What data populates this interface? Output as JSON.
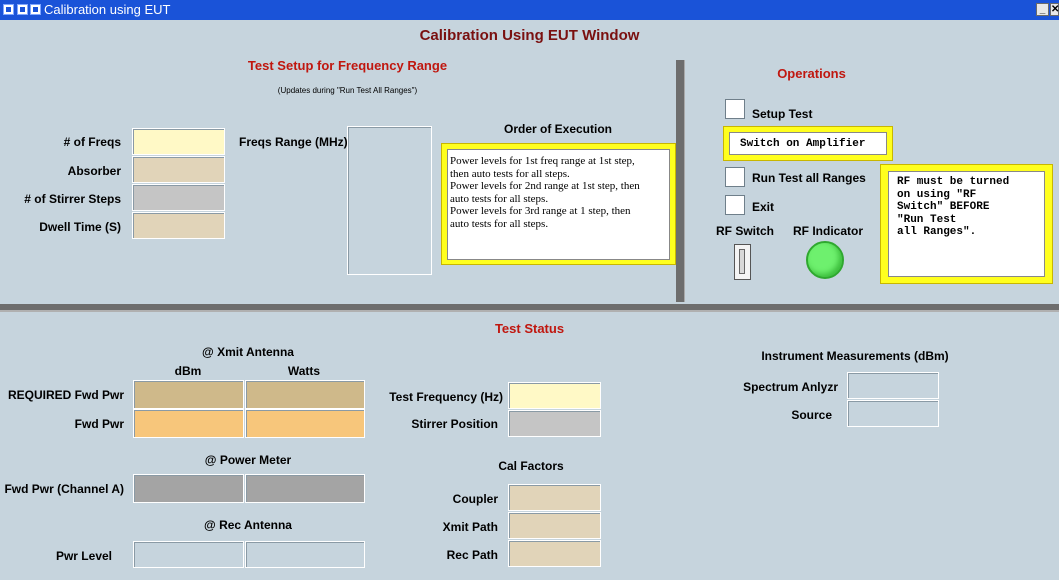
{
  "window": {
    "title": "Calibration using EUT"
  },
  "main_title": "Calibration Using EUT Window",
  "setup": {
    "title": "Test Setup for Frequency Range",
    "note": "(Updates during \"Run Test All Ranges\")",
    "num_freqs_label": "# of Freqs",
    "absorber_label": "Absorber",
    "stirrer_steps_label": "# of Stirrer Steps",
    "dwell_time_label": "Dwell Time (S)",
    "freqs_range_label": "Freqs Range (MHz)",
    "order_title": "Order of Execution",
    "order_lines": [
      "Power levels for 1st freq range at 1st step,",
      "then auto tests for all steps.",
      "Power levels for 2nd range at 1st step, then",
      "auto tests for all steps.",
      "Power levels for 3rd range at 1 step, then",
      "auto tests for all steps."
    ]
  },
  "operations": {
    "title": "Operations",
    "setup_test_label": "Setup Test",
    "switch_amp_text": "Switch on Amplifier",
    "run_all_label": "Run Test all Ranges",
    "exit_label": "Exit",
    "rf_switch_label": "RF Switch",
    "rf_indicator_label": "RF Indicator",
    "rf_note_lines": [
      "RF must be turned",
      "on using \"RF",
      "Switch\" BEFORE",
      "\"Run Test",
      "all Ranges\"."
    ]
  },
  "status": {
    "title": "Test Status",
    "xmit_antenna": "@ Xmit Antenna",
    "dbm_header": "dBm",
    "watts_header": "Watts",
    "required_fwd_pwr": "REQUIRED Fwd Pwr",
    "fwd_pwr": "Fwd Pwr",
    "power_meter": "@ Power Meter",
    "fwd_pwr_channel_a": "Fwd Pwr (Channel A)",
    "rec_antenna": "@ Rec Antenna",
    "pwr_level": "Pwr Level",
    "test_frequency": "Test Frequency (Hz)",
    "stirrer_position": "Stirrer Position",
    "cal_factors": "Cal Factors",
    "coupler": "Coupler",
    "xmit_path": "Xmit Path",
    "rec_path": "Rec Path",
    "instrument_measurements": "Instrument Measurements (dBm)",
    "spectrum_analyzer": "Spectrum Anlyzr",
    "source": "Source"
  },
  "colors": {
    "title_bar": "#1a53d8",
    "background": "#c6d4dd",
    "section_title": "#c0170f",
    "indicator_on": "#6ef06e",
    "highlight_frame": "#ffff1e"
  }
}
